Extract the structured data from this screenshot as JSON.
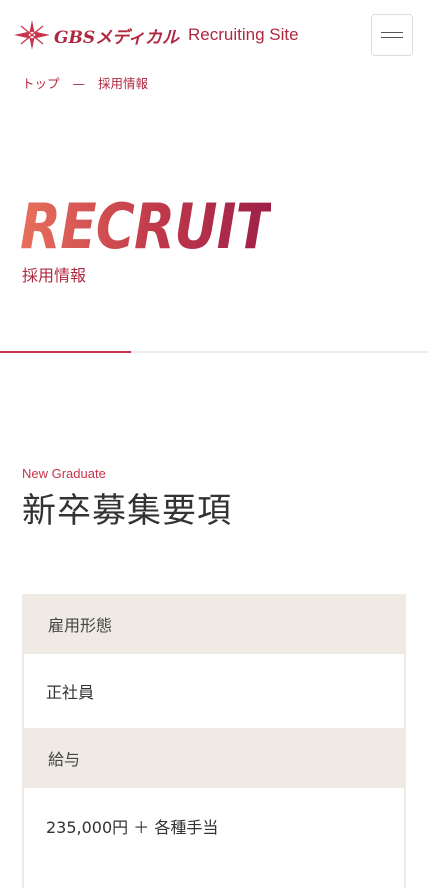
{
  "header": {
    "logo_text": "GBSメディカル",
    "logo_sub": "Recruiting Site"
  },
  "breadcrumb": {
    "home": "トップ",
    "separator": "—",
    "current": "採用情報"
  },
  "hero": {
    "title": "RECRUIT",
    "subtitle": "採用情報"
  },
  "section": {
    "eyebrow": "New Graduate",
    "title": "新卒募集要項"
  },
  "table": {
    "rows": [
      {
        "label": "雇用形態",
        "value": "正社員"
      },
      {
        "label": "給与",
        "value": "235,000円 ＋ 各種手当"
      }
    ]
  },
  "colors": {
    "brand": "#b0283f",
    "accent": "#c8344a",
    "table_head_bg": "#efebe4"
  }
}
